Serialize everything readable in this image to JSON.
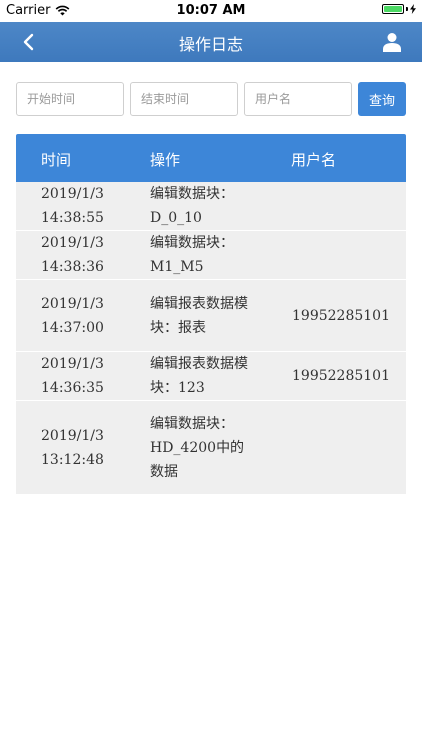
{
  "status_bar": {
    "carrier": "Carrier",
    "time": "10:07 AM"
  },
  "nav": {
    "title": "操作日志"
  },
  "filters": {
    "start_placeholder": "开始时间",
    "end_placeholder": "结束时间",
    "user_placeholder": "用户名",
    "search_label": "查询"
  },
  "table": {
    "headers": {
      "time": "时间",
      "operation": "操作",
      "user": "用户名"
    },
    "rows": [
      {
        "date": "2019/1/3",
        "clock": "14:38:55",
        "operation": "编辑数据块：D_0_10",
        "user": ""
      },
      {
        "date": "2019/1/3",
        "clock": "14:38:36",
        "operation": "编辑数据块：M1_M5",
        "user": ""
      },
      {
        "date": "2019/1/3",
        "clock": "14:37:00",
        "operation": "编辑报表数据模块：报表",
        "user": "19952285101"
      },
      {
        "date": "2019/1/3",
        "clock": "14:36:35",
        "operation": "编辑报表数据模块：123",
        "user": "19952285101"
      },
      {
        "date": "2019/1/3",
        "clock": "13:12:48",
        "operation": "编辑数据块：HD_4200中的数据",
        "user": ""
      }
    ]
  }
}
